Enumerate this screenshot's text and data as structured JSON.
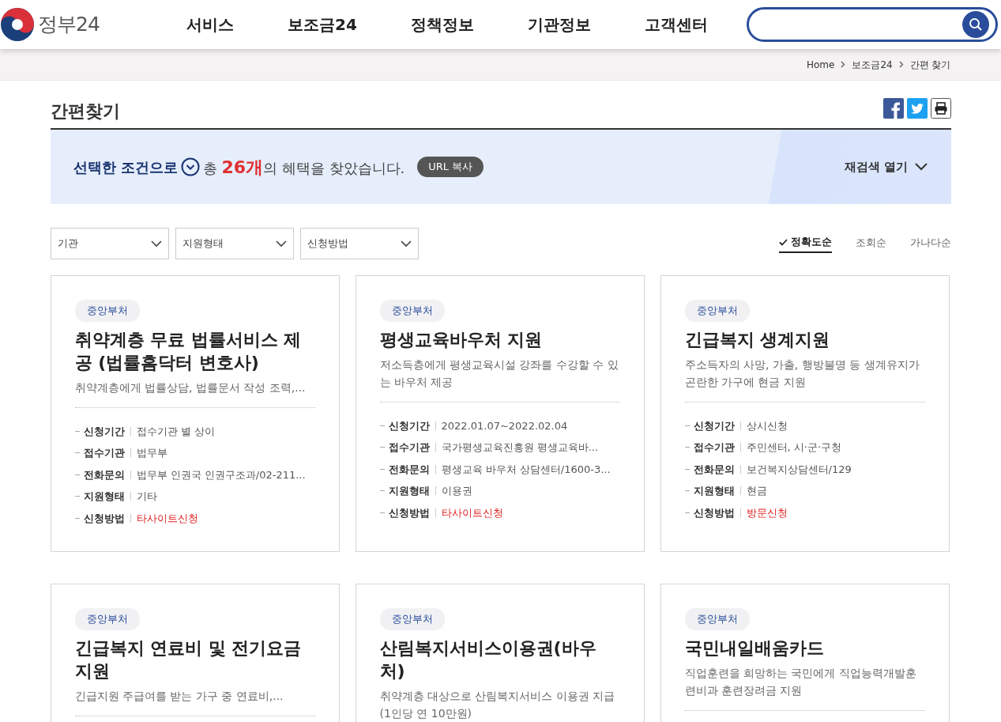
{
  "header": {
    "logo_text": "정부24",
    "nav": [
      {
        "label": "서비스"
      },
      {
        "label": "보조금24"
      },
      {
        "label": "정책정보"
      },
      {
        "label": "기관정보"
      },
      {
        "label": "고객센터"
      }
    ]
  },
  "breadcrumb": [
    "Home",
    "보조금24",
    "간편 찾기"
  ],
  "page_title": "간편찾기",
  "result_banner": {
    "condition": "선택한 조건으로",
    "prefix": "총",
    "count": "26개",
    "suffix": "의 혜택을 찾았습니다.",
    "copy_button": "URL 복사",
    "reopen": "재검색 열기"
  },
  "filters": [
    {
      "label": "기관"
    },
    {
      "label": "지원형태"
    },
    {
      "label": "신청방법"
    }
  ],
  "sort_options": [
    {
      "label": "정확도순",
      "selected": true
    },
    {
      "label": "조회순",
      "selected": false
    },
    {
      "label": "가나다순",
      "selected": false
    }
  ],
  "cards": [
    {
      "tag": "중앙부처",
      "title": "취약계층 무료 법률서비스 제공 (법률홈닥터 변호사)",
      "description": "취약계층에게 법률상담, 법률문서 작성 조력,...",
      "details": [
        {
          "label": "신청기간",
          "value": "접수기관 별 상이",
          "kind": "plain"
        },
        {
          "label": "접수기관",
          "value": "법무부",
          "kind": "plain"
        },
        {
          "label": "전화문의",
          "value": "법무부 인권국 인권구조과/02-211...",
          "kind": "plain"
        },
        {
          "label": "지원형태",
          "value": "기타",
          "kind": "plain"
        },
        {
          "label": "신청방법",
          "value": "타사이트신청",
          "kind": "method"
        }
      ]
    },
    {
      "tag": "중앙부처",
      "title": "평생교육바우처 지원",
      "description": "저소득층에게 평생교육시설 강좌를 수강할 수 있는 바우처 제공",
      "details": [
        {
          "label": "신청기간",
          "value": "2022.01.07~2022.02.04",
          "kind": "plain"
        },
        {
          "label": "접수기관",
          "value": "국가평생교육진흥원 평생교육바...",
          "kind": "plain"
        },
        {
          "label": "전화문의",
          "value": "평생교육 바우처 상담센터/1600-3...",
          "kind": "plain"
        },
        {
          "label": "지원형태",
          "value": "이용권",
          "kind": "plain"
        },
        {
          "label": "신청방법",
          "value": "타사이트신청",
          "kind": "method"
        }
      ]
    },
    {
      "tag": "중앙부처",
      "title": "긴급복지 생계지원",
      "description": "주소득자의 사망, 가출, 행방불명 등 생계유지가 곤란한 가구에 현금 지원",
      "details": [
        {
          "label": "신청기간",
          "value": "상시신청",
          "kind": "plain"
        },
        {
          "label": "접수기관",
          "value": "주민센터, 시·군·구청",
          "kind": "plain"
        },
        {
          "label": "전화문의",
          "value": "보건복지상담센터/129",
          "kind": "plain"
        },
        {
          "label": "지원형태",
          "value": "현금",
          "kind": "plain"
        },
        {
          "label": "신청방법",
          "value": "방문신청",
          "kind": "method"
        }
      ]
    },
    {
      "tag": "중앙부처",
      "title": "긴급복지 연료비 및 전기요금 지원",
      "description": "긴급지원 주급여를 받는 가구 중 연료비,..."
    },
    {
      "tag": "중앙부처",
      "title": "산림복지서비스이용권(바우처)",
      "description": "취약계층 대상으로 산림복지서비스 이용권 지급 (1인당 연 10만원)"
    },
    {
      "tag": "중앙부처",
      "title": "국민내일배움카드",
      "description": "직업훈련을 희망하는 국민에게 직업능력개발훈련비과 훈련장려금 지원"
    }
  ]
}
